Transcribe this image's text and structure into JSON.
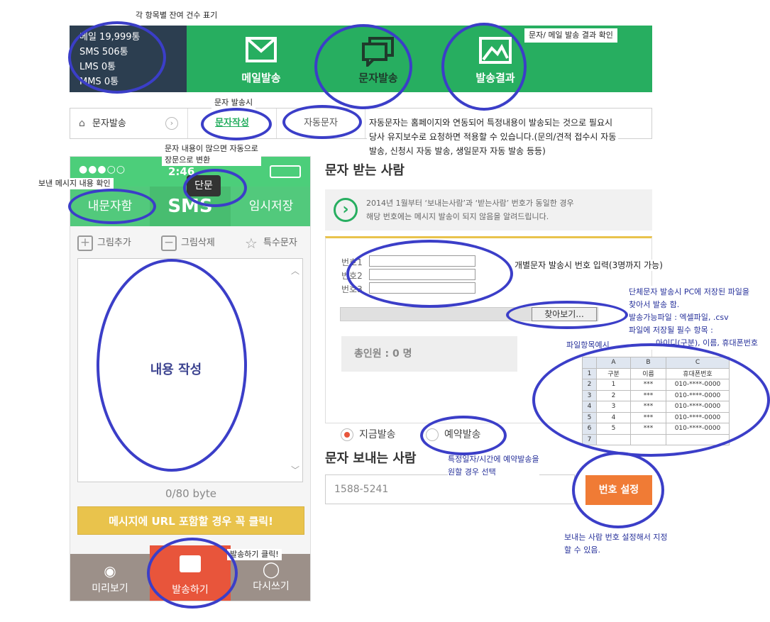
{
  "quota": {
    "mail": "메일 19,999통",
    "sms": "SMS 506통",
    "lms": "LMS 0통",
    "mms": "MMS 0통"
  },
  "topnav": {
    "mail": "메일발송",
    "sms": "문자발송",
    "result": "발송결과"
  },
  "breadcrumb": {
    "section": "문자발송",
    "compose": "문자작성",
    "auto": "자동문자"
  },
  "phone": {
    "time": "2:46",
    "tab_inbox": "내문자함",
    "tab_sms": "SMS",
    "tab_temp": "임시저장",
    "tooltip": "단문",
    "add_image": "그림추가",
    "del_image": "그림삭제",
    "special": "특수문자",
    "editor_hint": "내용 작성",
    "bytes": "0/80 byte",
    "url_button": "메시지에 URL 포함할 경우 꼭 클릭!",
    "preview": "미리보기",
    "send": "발송하기",
    "rewrite": "다시쓰기"
  },
  "recipient": {
    "title": "문자 받는 사람",
    "notice_line1": "2014년 1월부터 ‘보내는사람’과 ‘받는사람’ 번호가 동일한 경우",
    "notice_line2": "해당 번호에는 메시지 발송이 되지 않음을 알려드립니다.",
    "num1": "번호1",
    "num2": "번호2",
    "num3": "번호3",
    "browse": "찾아보기...",
    "total": "총인원 : 0 명",
    "send_now": "지금발송",
    "reserve": "예약발송"
  },
  "sender": {
    "title": "문자 보내는 사람",
    "number": "1588-5241",
    "set_button": "번호 설정"
  },
  "notes": {
    "quota": "각 항목별 잔여 건수 표기",
    "result": "문자/ 메일 발송 결과 확인",
    "compose": "문자 발송시",
    "auto_1": "자동문자는 홈페이지와 연동되어 특정내용이 발송되는 것으로 필요시",
    "auto_2": "당사 유지보수로 요청하면 적용할 수 있습니다.(문의/견적 접수시 자동",
    "auto_3": "발송, 신청시 자동 발송, 생일문자 자동 발송 등등)",
    "long_1": "문자 내용이 많으면 자동으로",
    "long_2": "장문으로 변환",
    "inbox": "보낸 메시지 내용 확인",
    "individual": "개별문자 발송시 번호 입력(3명까지 가능)",
    "group_1": "단체문자 발송시 PC에 저장된 파일을",
    "group_2": "찾아서 발송 함.",
    "group_3": "발송가능파일 : 엑셀파일, .csv",
    "group_4": "파일에 저장될 필수 항목 :",
    "group_5": "아이디(구분), 이름, 휴대폰번호",
    "sample": "파일항목예시",
    "reserve_1": "특정일자/시간에 예약발송을",
    "reserve_2": "원할 경우 선택",
    "send": "발송하기 클릭!",
    "sender_1": "보내는 사람 번호 설정해서 지정",
    "sender_2": "할 수 있음."
  },
  "excel_sample": {
    "cols": [
      "A",
      "B",
      "C"
    ],
    "header": [
      "구분",
      "이름",
      "휴대폰번호"
    ],
    "rows": [
      [
        "1",
        "***",
        "010-****-0000"
      ],
      [
        "2",
        "***",
        "010-****-0000"
      ],
      [
        "3",
        "***",
        "010-****-0000"
      ],
      [
        "4",
        "***",
        "010-****-0000"
      ],
      [
        "5",
        "***",
        "010-****-0000"
      ]
    ],
    "row_numbers": [
      "1",
      "2",
      "3",
      "4",
      "5",
      "6",
      "7"
    ]
  }
}
